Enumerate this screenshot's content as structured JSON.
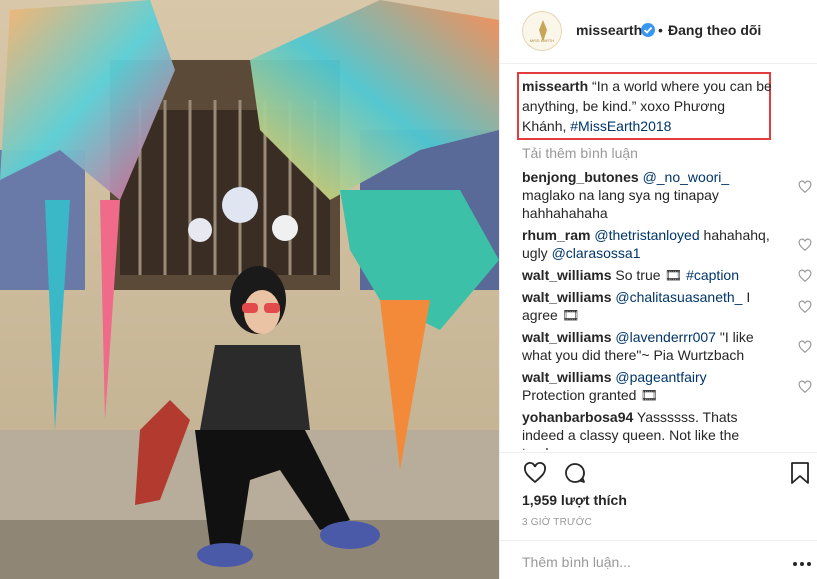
{
  "post": {
    "username": "missearth",
    "follow_label": "Đang theo dõi",
    "separator": "•",
    "avatar_text": "MISS EARTH",
    "caption_prefix": "“In a world where you can be anything, be kind.” xoxo Phương Khánh, ",
    "caption_hashtag": "#MissEarth2018",
    "load_more": "Tải thêm bình luận",
    "likes": "1,959 lượt thích",
    "time": "3 GIỜ TRƯỚC",
    "add_comment_placeholder": "Thêm bình luận...",
    "highlight_color": "#e23c3c"
  },
  "comments": [
    {
      "user": "benjong_butones",
      "mention": "@_no_woori_",
      "text": " maglako na lang sya ng tinapay hahhahahaha"
    },
    {
      "user": "rhum_ram",
      "mention": "@thetristanloyed",
      "text": " hahahahq, ugly ",
      "mention2": "@clarasossa1"
    },
    {
      "user": "walt_williams",
      "pre": "So true 🎞 ",
      "mention": "#caption",
      "text": ""
    },
    {
      "user": "walt_williams",
      "mention": "@chalitasuasaneth_",
      "text": " I agree 🎞"
    },
    {
      "user": "walt_williams",
      "mention": "@lavenderrr007",
      "text": " \"I like what you did there\"~ Pia Wurtzbach"
    },
    {
      "user": "walt_williams",
      "mention": "@pageantfairy",
      "text": " Protection granted 🎞"
    },
    {
      "user": "yohanbarbosa94",
      "pre": "Yassssss. Thats indeed a classy queen. Not like the trash",
      "mention": "",
      "text": ""
    }
  ],
  "icons": {
    "like": "heart-icon",
    "comment": "comment-icon",
    "save": "bookmark-icon",
    "more": "more-options-icon",
    "verified": "verified-badge-icon"
  }
}
